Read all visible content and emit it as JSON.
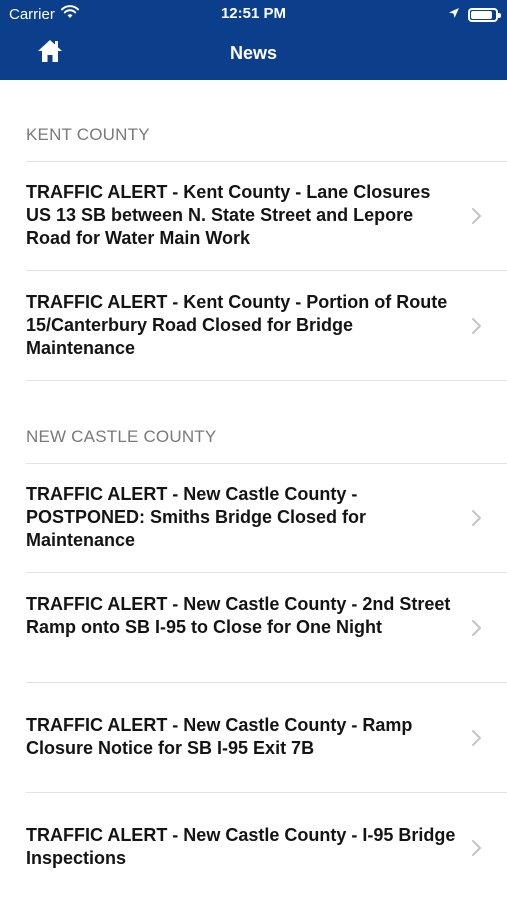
{
  "status_bar": {
    "carrier": "Carrier",
    "time": "12:51 PM",
    "battery_level": 0.9
  },
  "nav": {
    "title": "News",
    "home_icon": "home-icon"
  },
  "sections": [
    {
      "header": "KENT COUNTY",
      "items": [
        {
          "title": "TRAFFIC ALERT - Kent County - Lane Closures US 13 SB between N. State Street and Lepore Road for Water Main Work"
        },
        {
          "title": "TRAFFIC ALERT - Kent County - Portion of Route 15/Canterbury Road Closed for Bridge Maintenance"
        }
      ]
    },
    {
      "header": "NEW CASTLE COUNTY",
      "items": [
        {
          "title": "TRAFFIC ALERT - New Castle County - POSTPONED: Smiths Bridge Closed for Maintenance"
        },
        {
          "title": "TRAFFIC ALERT - New Castle County - 2nd Street Ramp onto SB I-95 to Close for One Night"
        },
        {
          "title": "TRAFFIC ALERT - New Castle County - Ramp Closure Notice for SB I-95 Exit 7B"
        },
        {
          "title": "TRAFFIC ALERT - New Castle County - I-95 Bridge Inspections"
        }
      ]
    }
  ],
  "colors": {
    "header_bg": "#0b3f8c",
    "section_header_text": "#7a7a7a",
    "separator": "#e2e2e2",
    "chevron": "#c4c4c4"
  }
}
